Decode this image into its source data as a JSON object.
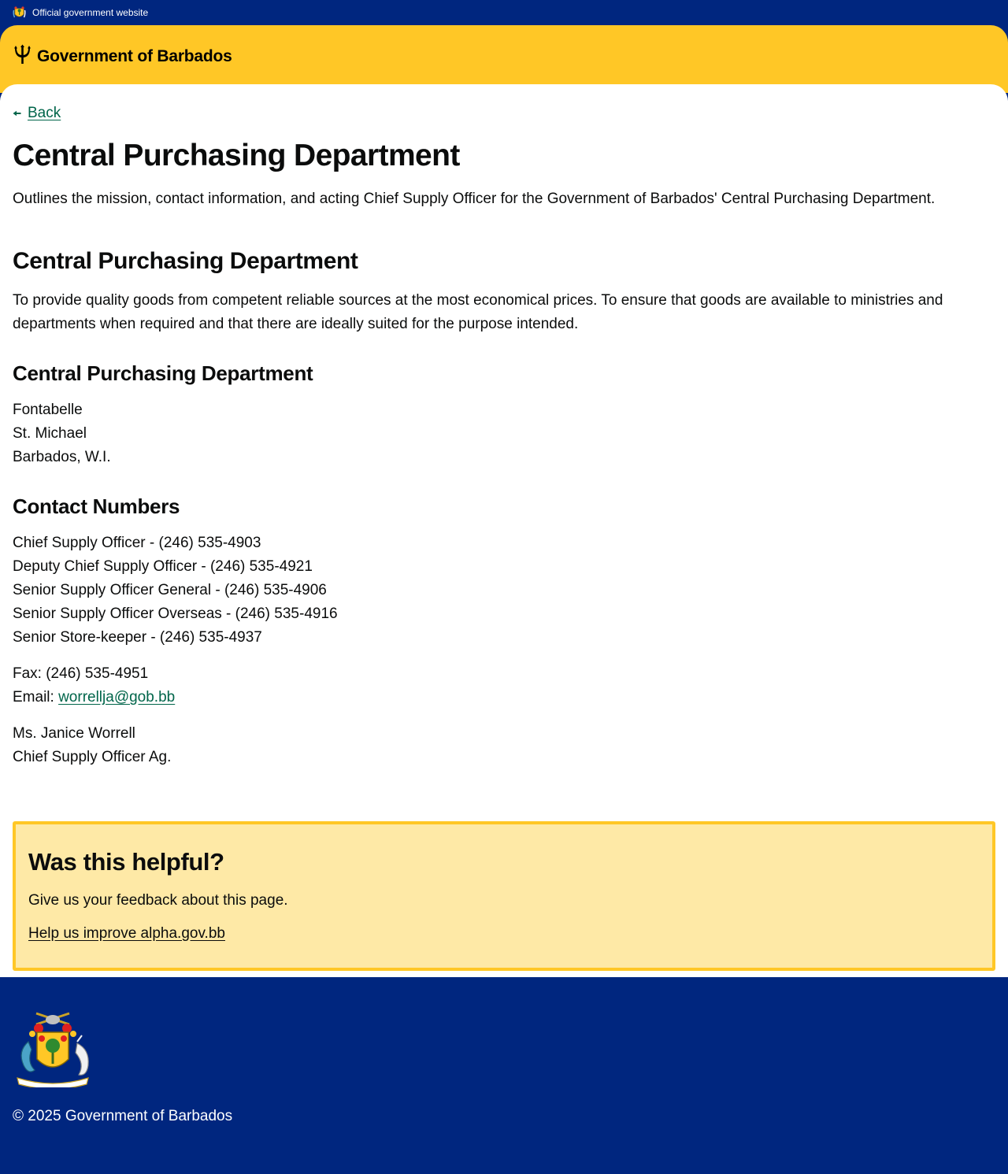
{
  "topbar": {
    "label": "Official government website"
  },
  "header": {
    "brand": "Government of Barbados"
  },
  "nav": {
    "back_label": "Back"
  },
  "page": {
    "title": "Central Purchasing Department",
    "lead": "Outlines the mission, contact information, and acting Chief Supply Officer for the Government of Barbados' Central Purchasing Department."
  },
  "mission": {
    "heading": "Central Purchasing Department",
    "text": "To provide quality goods from competent reliable sources at the most economical prices. To ensure that goods are available to ministries and departments when required and that there are ideally suited for the purpose intended."
  },
  "address": {
    "heading": "Central Purchasing Department",
    "lines": [
      "Fontabelle",
      "St. Michael",
      "Barbados, W.I."
    ]
  },
  "contacts": {
    "heading": "Contact Numbers",
    "numbers": [
      "Chief Supply Officer - (246) 535-4903",
      "Deputy Chief Supply Officer - (246) 535-4921",
      "Senior Supply Officer General - (246) 535-4906",
      "Senior Supply Officer Overseas - (246) 535-4916",
      "Senior Store-keeper - (246) 535-4937"
    ],
    "fax": "Fax: (246) 535-4951",
    "email_label": "Email: ",
    "email": "worrellja@gob.bb",
    "officer_name": "Ms. Janice Worrell",
    "officer_title": "Chief Supply Officer Ag."
  },
  "feedback": {
    "heading": "Was this helpful?",
    "text": "Give us your feedback about this page.",
    "link": "Help us improve alpha.gov.bb"
  },
  "footer": {
    "copyright": "© 2025 Government of Barbados"
  },
  "colors": {
    "navy": "#00267f",
    "gold": "#ffc726",
    "link_green": "#00654a",
    "feedback_bg": "#fee9a6"
  },
  "icons": {
    "topbar": "coat-of-arms-icon",
    "brand": "trident-icon",
    "back": "arrow-left-icon",
    "footer": "coat-of-arms-icon"
  }
}
